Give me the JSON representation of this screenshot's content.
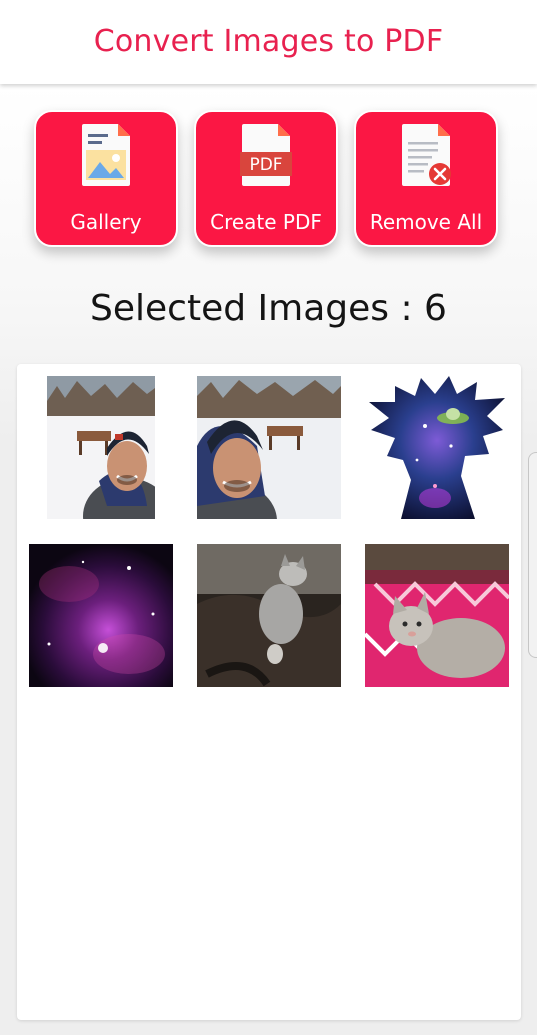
{
  "app": {
    "title": "Convert Images to PDF",
    "accent_color": "#e8214f",
    "button_color": "#fb1744"
  },
  "actions": [
    {
      "id": "gallery",
      "label": "Gallery",
      "icon": "gallery-icon"
    },
    {
      "id": "create_pdf",
      "label": "Create PDF",
      "icon": "pdf-file-icon"
    },
    {
      "id": "remove_all",
      "label": "Remove All",
      "icon": "remove-document-icon"
    }
  ],
  "pdf_badge_text": "PDF",
  "selected": {
    "text": "Selected Images : 6",
    "count": 6
  },
  "images": [
    {
      "name": "selfie-snow-1",
      "subject": "selfie in snowy park"
    },
    {
      "name": "selfie-snow-2",
      "subject": "selfie in snowy park"
    },
    {
      "name": "galaxy-silhouette",
      "subject": "galaxy head silhouette"
    },
    {
      "name": "purple-nebula",
      "subject": "purple nebula"
    },
    {
      "name": "cat-on-lap",
      "subject": "grey cat on lap"
    },
    {
      "name": "cat-on-blanket",
      "subject": "grey cat on pink blanket"
    }
  ]
}
